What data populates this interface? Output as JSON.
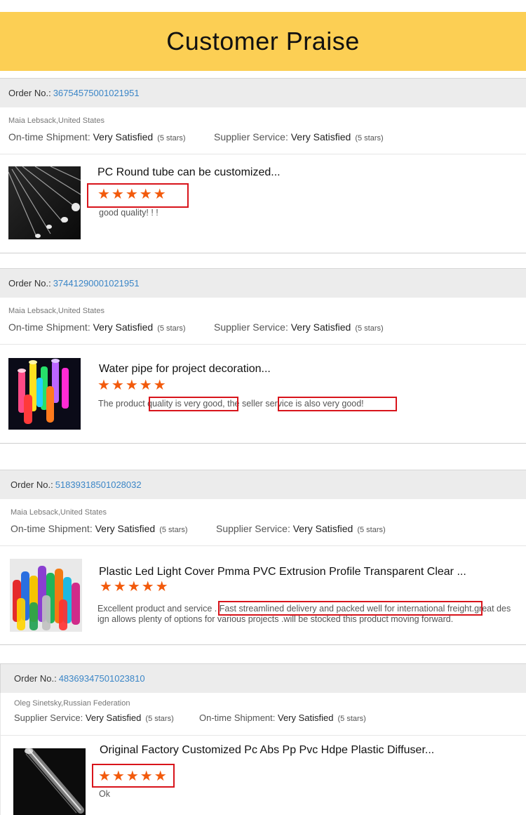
{
  "page": {
    "title": "Customer Praise"
  },
  "labels": {
    "order_no": "Order No.:",
    "on_time": "On-time Shipment:",
    "supplier": "Supplier Service:"
  },
  "reviews": [
    {
      "order_no": "36754575001021951",
      "buyer": "Maia Lebsack,United States",
      "rating1": {
        "value": "Very Satisfied",
        "stars": "(5 stars)"
      },
      "rating2": {
        "value": "Very Satisfied",
        "stars": "(5 stars)"
      },
      "product_title": "PC Round tube can be customized...",
      "stars": "★★★★★",
      "comment": "good quality! ! !"
    },
    {
      "order_no": "37441290001021951",
      "buyer": "Maia Lebsack,United States",
      "rating1": {
        "value": "Very Satisfied",
        "stars": "(5 stars)"
      },
      "rating2": {
        "value": "Very Satisfied",
        "stars": "(5 stars)"
      },
      "product_title": "Water pipe for project decoration...",
      "stars": "★★★★★",
      "comment": "The product quality is very good, the seller service is also very good!"
    },
    {
      "order_no": "51839318501028032",
      "buyer": "Maia Lebsack,United States",
      "rating1": {
        "value": "Very Satisfied",
        "stars": "(5 stars)"
      },
      "rating2": {
        "value": "Very Satisfied",
        "stars": "(5 stars)"
      },
      "product_title": "Plastic Led Light Cover Pmma PVC Extrusion Profile Transparent Clear ...",
      "stars": "★★★★★",
      "comment_line1": "Excellent product and service . Fast streamlined delivery and packed well for international freight.great des",
      "comment_line2": "ign allows plenty of options for various projects .will be stocked this product  moving forward."
    },
    {
      "order_no": "48369347501023810",
      "buyer": "Oleg Sinetsky,Russian Federation",
      "rating1": {
        "value": "Very Satisfied",
        "stars": "(5 stars)"
      },
      "rating2": {
        "value": "Very Satisfied",
        "stars": "(5 stars)"
      },
      "product_title": "Original Factory Customized Pc Abs Pp Pvc Hdpe Plastic Diffuser...",
      "stars": "★★★★★",
      "comment": "Ok"
    }
  ],
  "colors": {
    "header_bg": "#fccf54",
    "order_link": "#3b86c7",
    "star": "#f25a0c",
    "highlight_box": "#d8141b"
  }
}
